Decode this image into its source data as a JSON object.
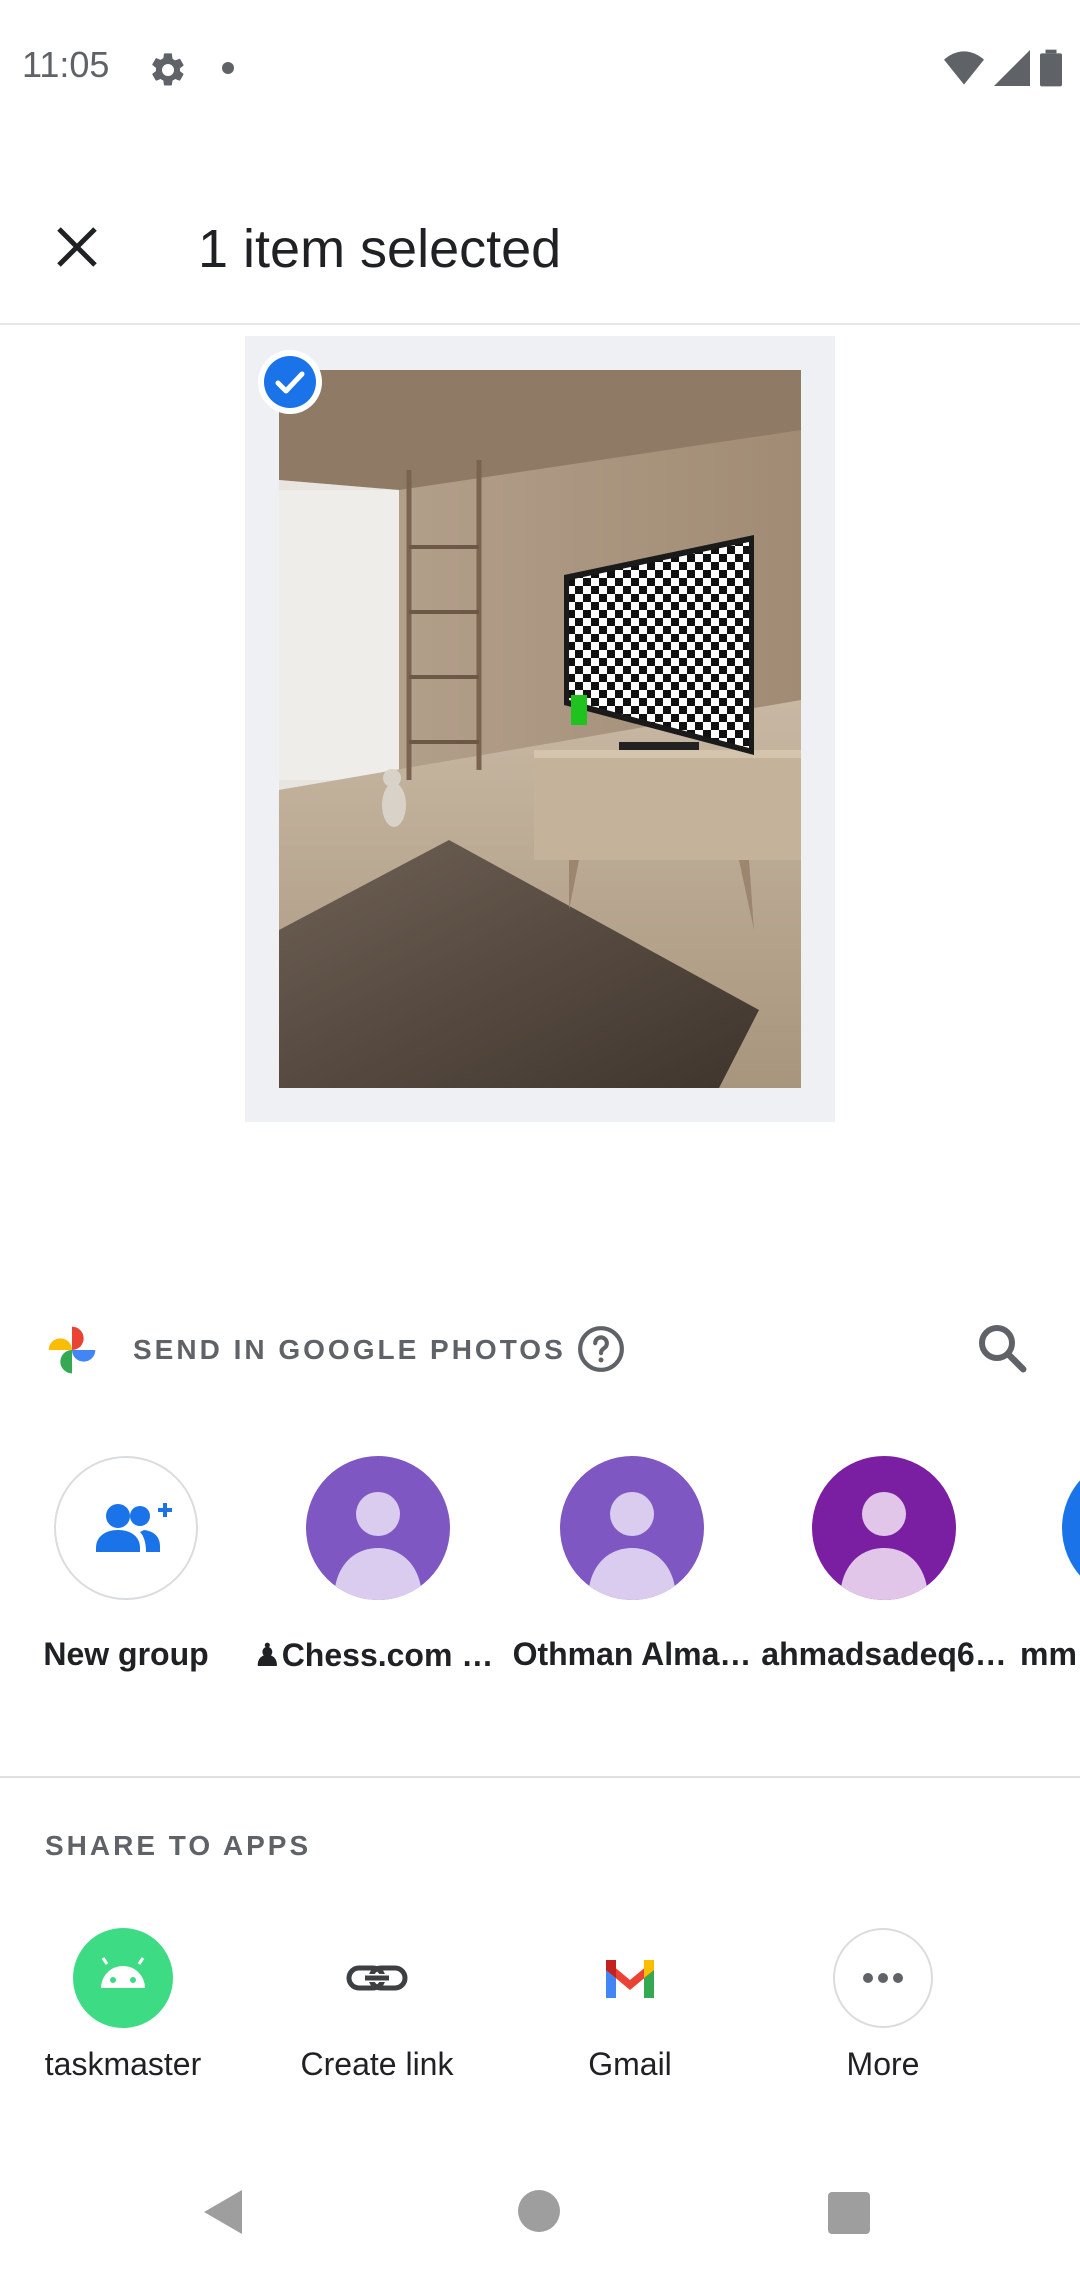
{
  "status_bar": {
    "time": "11:05"
  },
  "header": {
    "title": "1 item selected"
  },
  "google_photos": {
    "label": "SEND IN GOOGLE PHOTOS"
  },
  "contacts": [
    {
      "name": "New group"
    },
    {
      "name": "♟Chess.com S…"
    },
    {
      "name": "Othman Alma…"
    },
    {
      "name": "ahmadsadeq6…"
    },
    {
      "name": "mm"
    }
  ],
  "share_section": {
    "title": "SHARE TO APPS"
  },
  "apps": [
    {
      "label": "taskmaster"
    },
    {
      "label": "Create link"
    },
    {
      "label": "Gmail"
    },
    {
      "label": "More"
    }
  ],
  "colors": {
    "accent_blue": "#1a73e8",
    "avatar_purple": "#7e57c2",
    "avatar_dark_purple": "#7b1fa2",
    "android_green": "#3ddc84"
  }
}
